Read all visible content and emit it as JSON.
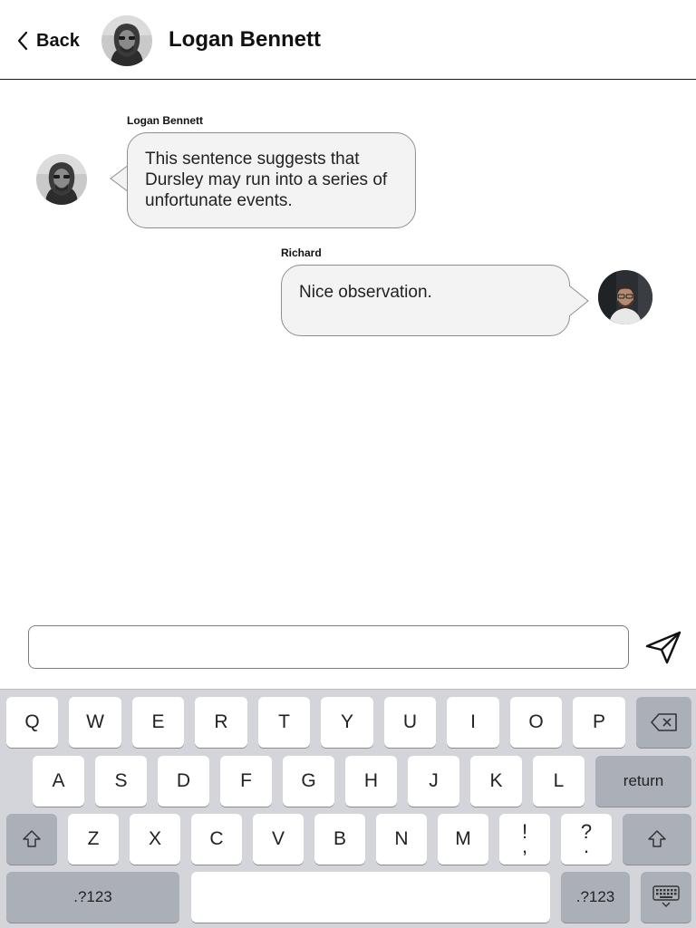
{
  "header": {
    "back_label": "Back",
    "contact_name": "Logan Bennett"
  },
  "messages": [
    {
      "sender": "Logan Bennett",
      "text": "This sentence suggests that Dursley may run into a series of unfortunate events.",
      "side": "left"
    },
    {
      "sender": "Richard",
      "text": "Nice observation.",
      "side": "right"
    }
  ],
  "composer": {
    "value": "",
    "placeholder": ""
  },
  "icons": {
    "back": "chevron-left-icon",
    "send": "paper-plane-icon",
    "backspace": "backspace-icon",
    "shift": "shift-icon",
    "keyboard_hide": "keyboard-hide-icon"
  },
  "keyboard": {
    "row1": [
      "Q",
      "W",
      "E",
      "R",
      "T",
      "Y",
      "U",
      "I",
      "O",
      "P"
    ],
    "row2": [
      "A",
      "S",
      "D",
      "F",
      "G",
      "H",
      "J",
      "K",
      "L"
    ],
    "row3": [
      "Z",
      "X",
      "C",
      "V",
      "B",
      "N",
      "M"
    ],
    "punct1_top": "!",
    "punct1_bottom": ",",
    "punct2_top": "?",
    "punct2_bottom": ".",
    "return_label": "return",
    "numbers_label": ".?123"
  },
  "colors": {
    "bubble_bg": "#f3f3f3",
    "keyboard_bg": "#d3d5da",
    "dark_key": "#abb0b8"
  }
}
